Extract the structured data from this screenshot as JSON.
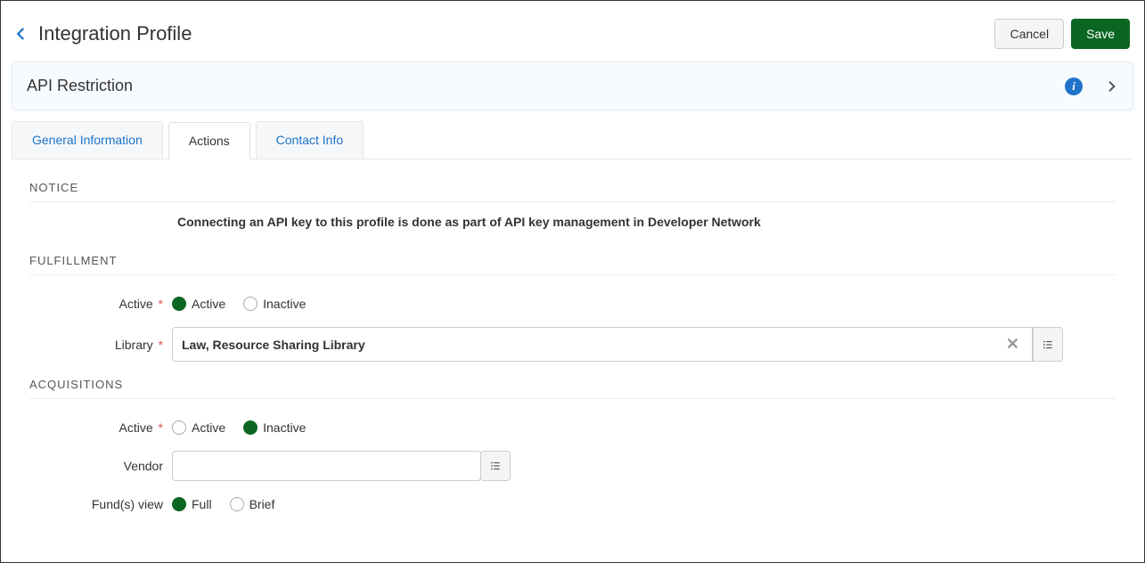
{
  "header": {
    "title": "Integration Profile",
    "cancel": "Cancel",
    "save": "Save"
  },
  "subheader": {
    "title": "API Restriction"
  },
  "tabs": {
    "general": "General Information",
    "actions": "Actions",
    "contact": "Contact Info"
  },
  "sections": {
    "notice": {
      "heading": "NOTICE",
      "text": "Connecting an API key to this profile is done as part of API key management in Developer Network"
    },
    "fulfillment": {
      "heading": "FULFILLMENT",
      "active_label": "Active",
      "active_options": {
        "active": "Active",
        "inactive": "Inactive"
      },
      "active_value": "active",
      "library_label": "Library",
      "library_value": "Law, Resource Sharing Library"
    },
    "acquisitions": {
      "heading": "ACQUISITIONS",
      "active_label": "Active",
      "active_options": {
        "active": "Active",
        "inactive": "Inactive"
      },
      "active_value": "inactive",
      "vendor_label": "Vendor",
      "vendor_value": "",
      "funds_label": "Fund(s) view",
      "funds_options": {
        "full": "Full",
        "brief": "Brief"
      },
      "funds_value": "full"
    }
  }
}
